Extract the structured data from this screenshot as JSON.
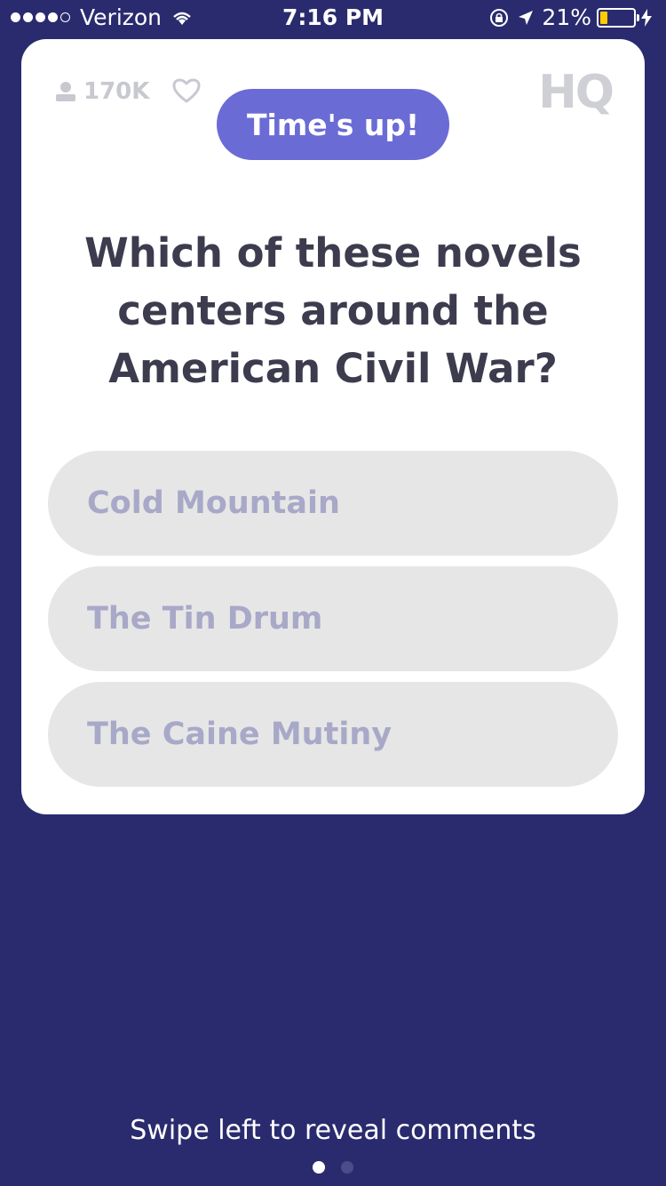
{
  "status_bar": {
    "carrier": "Verizon",
    "time": "7:16 PM",
    "battery_percent": "21%",
    "battery_level": 0.21,
    "signal_bars": 4,
    "icons": [
      "wifi-icon",
      "rotation-lock-icon",
      "location-arrow-icon",
      "charging-bolt-icon"
    ]
  },
  "card": {
    "viewer_count": "170K",
    "logo": "HQ",
    "timer_label": "Time's up!",
    "question": "Which of these novels centers around the American Civil War?",
    "answers": [
      {
        "label": "Cold Mountain"
      },
      {
        "label": "The Tin Drum"
      },
      {
        "label": "The Caine Mutiny"
      }
    ]
  },
  "footer": {
    "hint": "Swipe left to reveal comments",
    "page_count": 2,
    "active_page": 1
  },
  "colors": {
    "background": "#2a2b6e",
    "timer_pill": "#6b6bd6",
    "answer_bg": "#e6e6e6",
    "answer_text": "#a8a8c8",
    "question_text": "#3c3c4e",
    "battery_fill": "#ffcc00"
  }
}
